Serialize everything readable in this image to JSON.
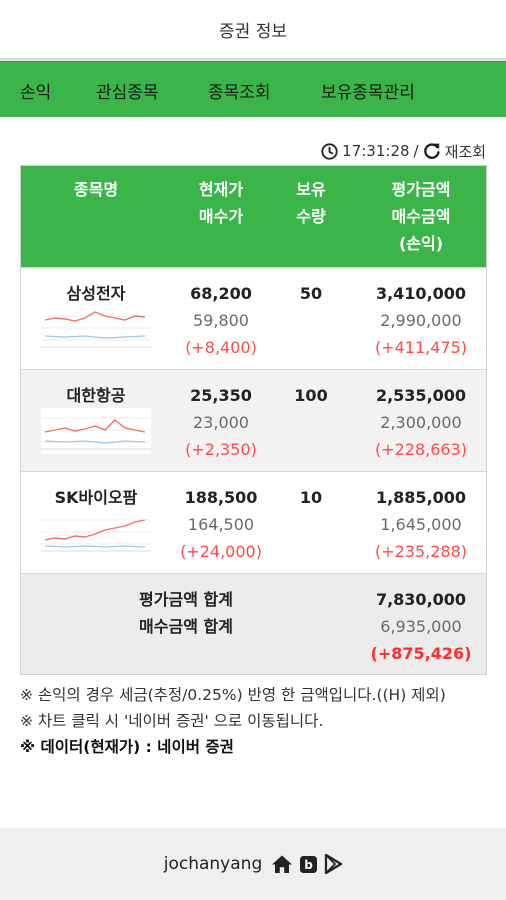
{
  "app": {
    "title": "증권 정보"
  },
  "nav": {
    "items": [
      "손익",
      "관심종목",
      "종목조회",
      "보유종목관리"
    ]
  },
  "timestamp": {
    "time": "17:31:28",
    "separator": "/",
    "refresh_label": "재조회"
  },
  "table": {
    "headers": {
      "name": "종목명",
      "price_current": "현재가",
      "price_buy": "매수가",
      "qty_1": "보유",
      "qty_2": "수량",
      "value_eval": "평가금액",
      "value_buy": "매수금액",
      "value_pl": "(손익)"
    },
    "rows": [
      {
        "name": "삼성전자",
        "current": "68,200",
        "buy": "59,800",
        "diff": "(+8,400)",
        "qty": "50",
        "eval": "3,410,000",
        "buy_total": "2,990,000",
        "pl": "(+411,475)"
      },
      {
        "name": "대한항공",
        "current": "25,350",
        "buy": "23,000",
        "diff": "(+2,350)",
        "qty": "100",
        "eval": "2,535,000",
        "buy_total": "2,300,000",
        "pl": "(+228,663)"
      },
      {
        "name": "SK바이오팜",
        "current": "188,500",
        "buy": "164,500",
        "diff": "(+24,000)",
        "qty": "10",
        "eval": "1,885,000",
        "buy_total": "1,645,000",
        "pl": "(+235,288)"
      }
    ],
    "totals": {
      "eval_label": "평가금액 합계",
      "buy_label": "매수금액 합계",
      "eval": "7,830,000",
      "buy": "6,935,000",
      "pl": "(+875,426)"
    }
  },
  "notes": {
    "line1": "※ 손익의 경우 세금(추정/0.25%) 반영 한 금액입니다.((H) 제외)",
    "line2": "※ 차트 클릭 시 '네이버 증권' 으로 이동됩니다.",
    "line3": "※ 데이터(현재가) : 네이버 증권"
  },
  "footer": {
    "author": "jochanyang",
    "icons": [
      "home-icon",
      "blog-icon",
      "play-store-icon"
    ]
  },
  "colors": {
    "accent": "#3bb54a",
    "profit": "#ff4a4a",
    "footer_bg": "#efefef"
  }
}
